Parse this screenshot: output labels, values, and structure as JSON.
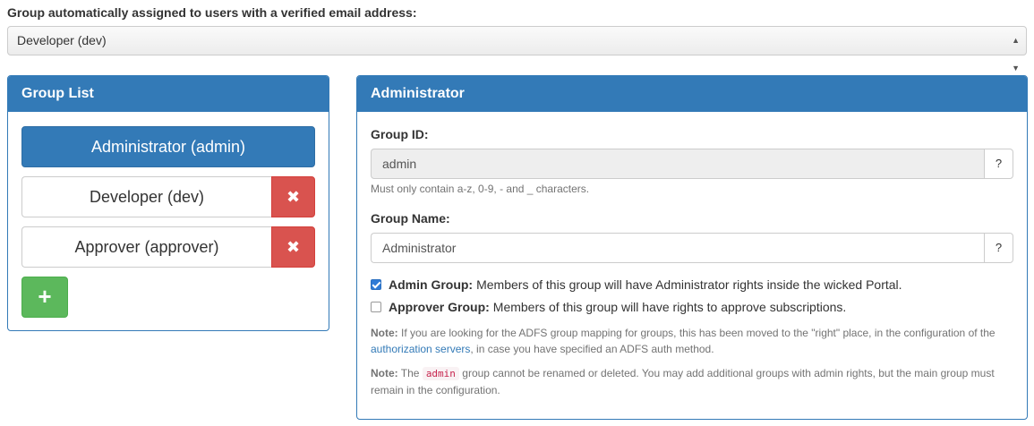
{
  "default_group": {
    "label": "Group automatically assigned to users with a verified email address:",
    "selected": "Developer (dev)"
  },
  "group_list": {
    "title": "Group List",
    "items": [
      {
        "label": "Administrator (admin)",
        "active": true,
        "deletable": false
      },
      {
        "label": "Developer (dev)",
        "active": false,
        "deletable": true
      },
      {
        "label": "Approver (approver)",
        "active": false,
        "deletable": true
      }
    ],
    "delete_glyph": "✖",
    "add_glyph": "+"
  },
  "detail": {
    "title": "Administrator",
    "group_id_label": "Group ID:",
    "group_id_value": "admin",
    "group_id_help": "Must only contain a-z, 0-9, - and _ characters.",
    "group_name_label": "Group Name:",
    "group_name_value": "Administrator",
    "help_glyph": "?",
    "admin_group": {
      "checked": true,
      "title": "Admin Group:",
      "text": "Members of this group will have Administrator rights inside the wicked Portal."
    },
    "approver_group": {
      "checked": false,
      "title": "Approver Group:",
      "text": "Members of this group will have rights to approve subscriptions."
    },
    "note1": {
      "prefix": "Note:",
      "text_before": " If you are looking for the ADFS group mapping for groups, this has been moved to the \"right\" place, in the configuration of the ",
      "link": "authorization servers",
      "text_after": ", in case you have specified an ADFS auth method."
    },
    "note2": {
      "prefix": "Note:",
      "text_before": " The ",
      "code": "admin",
      "text_after": " group cannot be renamed or deleted. You may add additional groups with admin rights, but the main group must remain in the configuration."
    }
  },
  "colors": {
    "primary": "#337ab7",
    "danger": "#d9534f",
    "success": "#5cb85c"
  }
}
